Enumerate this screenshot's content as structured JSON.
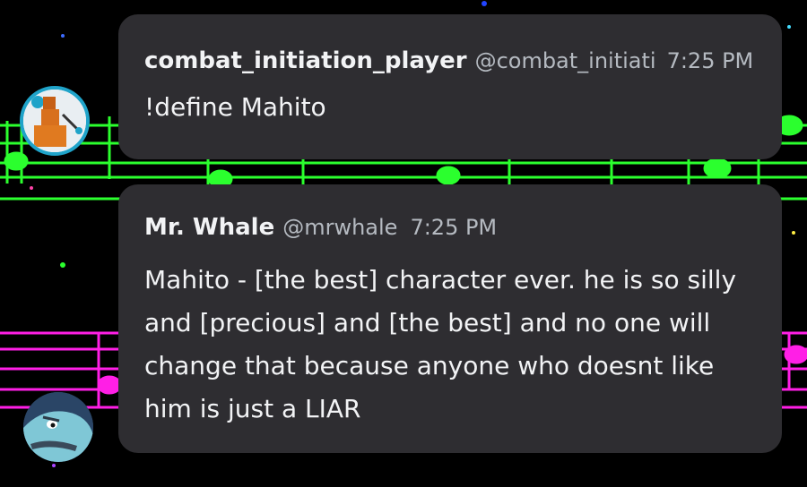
{
  "messages": [
    {
      "username": "combat_initiation_player",
      "handle": "@combat_initiation_player",
      "time": "7:25 PM",
      "text": "!define Mahito",
      "avatar_icon": "roblox-character-avatar"
    },
    {
      "username": "Mr. Whale",
      "handle": "@mrwhale",
      "time": "7:25 PM",
      "text": "Mahito - [the best] character ever. he is so silly and [precious] and [the best] and no one will change that because anyone who doesnt like him is just a LIAR",
      "avatar_icon": "whale-cartoon-avatar"
    }
  ],
  "colors": {
    "bubble": "#2e2d31",
    "staff_green": "#2bff2e",
    "staff_magenta": "#ff1fe6",
    "username": "#f2f3f5",
    "meta": "#b5bac1"
  }
}
